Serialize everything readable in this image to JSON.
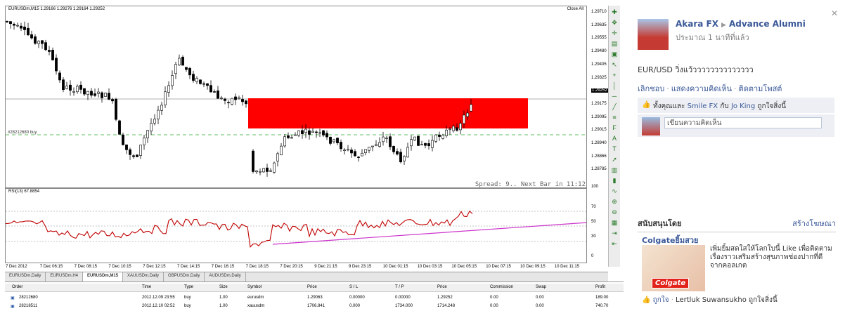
{
  "mt4": {
    "main_chart_title": "EURUSDm,M15 1.29166 1.29276 1.29164 1.29252",
    "close_all": "Close All",
    "order_label": "#28212680 buy",
    "status": "Spread: 9.. Next Bar in 11:12",
    "rsi_title": "RSI(13) 67.8854",
    "rsi_axis": [
      "100",
      "70",
      "50",
      "30",
      "0"
    ],
    "price_axis": [
      "1.29710",
      "1.29635",
      "1.29555",
      "1.29480",
      "1.29405",
      "1.29325",
      "1.29252",
      "1.29175",
      "1.29095",
      "1.29015",
      "1.28940",
      "1.28866",
      "1.28785"
    ],
    "time_axis": [
      "7 Dec 2012",
      "7 Dec 06:15",
      "7 Dec 08:15",
      "7 Dec 10:15",
      "7 Dec 12:15",
      "7 Dec 14:15",
      "7 Dec 16:15",
      "7 Dec 18:15",
      "7 Dec 20:15",
      "9 Dec 21:15",
      "9 Dec 23:15",
      "10 Dec 01:15",
      "10 Dec 03:15",
      "10 Dec 05:15",
      "10 Dec 07:15",
      "10 Dec 09:15",
      "10 Dec 11:15"
    ],
    "tabs": [
      "EURUSDm,Daily",
      "EURUSDm,H4",
      "EURUSDm,M15",
      "XAUUSDm,Daily",
      "GBPUSDm,Daily",
      "AUDUSDm,Daily"
    ],
    "active_tab": 2,
    "terminal": {
      "headers": [
        "Order",
        "Time",
        "Type",
        "Size",
        "Symbol",
        "Price",
        "S / L",
        "T / P",
        "Price",
        "Commission",
        "Swap",
        "Profit"
      ],
      "rows": [
        [
          "28212680",
          "2012.12.09 23:55",
          "buy",
          "1.00",
          "eurusdm",
          "1.29063",
          "0.00000",
          "0.00000",
          "1.29252",
          "0.00",
          "0.00",
          "189.00"
        ],
        [
          "28218511",
          "2012.12.10 02:52",
          "buy",
          "1.00",
          "xauusdm",
          "1706.841",
          "0.000",
          "1734.000",
          "1714.248",
          "0.00",
          "0.00",
          "740.70"
        ]
      ]
    },
    "colors": {
      "bull": "#ffffff",
      "bear": "#000000",
      "zone": "#ff0000",
      "rsi": "#c00000",
      "trend": "#cc33cc",
      "order_line": "#33aa33"
    }
  },
  "facebook": {
    "author": "Akara FX",
    "group": "Advance Alumni",
    "time": "ประมาณ 1 นาทีที่แล้ว",
    "post_text": "EUR/USD วิ่งแว้วววววววววววววว",
    "actions": [
      "เลิกชอบ",
      "แสดงความคิดเห็น",
      "ติดตามโพสต์"
    ],
    "likes_prefix": "ทั้งคุณและ ",
    "likes_name1": "Smile FX",
    "likes_mid": " กับ ",
    "likes_name2": "Jo King",
    "likes_suffix": " ถูกใจสิ่งนี้",
    "comment_placeholder": "เขียนความคิดเห็น",
    "sponsored": "สนับสนุนโดย",
    "create_ad": "สร้างโฆษณา",
    "ad_title": "Colgateยิ้มสวย",
    "ad_logo": "Colgate",
    "ad_text": "เพิ่มยิ้มสดใสให้โลกใบนี้ Like เพื่อติดตามเรื่องราวเสริมสร้างสุขภาพช่องปากที่ดีจากคอลเกต",
    "ad_like": "ถูกใจ",
    "ad_like_by": "Lertluk Suwansukho ถูกใจสิ่งนี้"
  }
}
